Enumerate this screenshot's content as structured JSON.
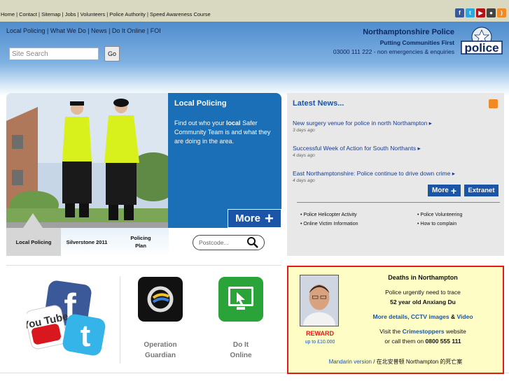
{
  "top_links": "Home | Contact | Sitemap | Jobs | Volunteers | Police Authority | Speed Awareness Course",
  "social_icons": [
    "facebook-icon",
    "twitter-icon",
    "youtube-icon",
    "flickr-icon",
    "rss-icon"
  ],
  "main_nav": "Local Policing | What We Do | News | Do It Online | FOI",
  "search": {
    "placeholder": "Site Search",
    "button": "Go"
  },
  "brand": {
    "name": "Northamptonshire Police",
    "tagline": "Putting Communities First",
    "phone": "03000 111 222 - non emergencies & enquiries",
    "logo_text": "police"
  },
  "local_policing": {
    "title": "Local Policing",
    "desc_pre": "Find out who your ",
    "desc_bold": "local",
    "desc_post": " Safer Community Team is and what they are doing in the area.",
    "more": "More",
    "tabs": [
      "Local Policing",
      "Silverstone 2011",
      "Policing Plan"
    ],
    "postcode_placeholder": "Postcode..."
  },
  "news": {
    "title": "Latest News...",
    "items": [
      {
        "title": "New surgery venue for police in north Northampton",
        "date": "3 days ago"
      },
      {
        "title": "Successful Week of Action for South Northants",
        "date": "4 days ago"
      },
      {
        "title": "East Northamptonshire: Police continue to drive down crime",
        "date": "4 days ago"
      }
    ],
    "more": "More",
    "extranet": "Extranet",
    "quick_links": [
      "Police Helicopter Activity",
      "Police Volunteering",
      "Online Victim Information",
      "How to complain"
    ]
  },
  "bottom": {
    "op_guardian": "Operation Guardian",
    "do_it_online": "Do It Online",
    "youtube_text": "You Tube"
  },
  "appeal": {
    "title": "Deaths in Northampton",
    "line1": "Police urgently need to trace",
    "line2": "52 year old Anxiang Du",
    "details_pre": "More details",
    "details_mid": "CCTV images",
    "details_amp": "&",
    "details_video": "Video",
    "visit_pre": "Visit the ",
    "visit_link": "Crimestoppers",
    "visit_post": " website",
    "call": "or call them on ",
    "call_num": "0800 555 111",
    "reward": "REWARD",
    "reward_amount": "up to £10.000",
    "mandarin_link": "Mandarin version",
    "mandarin_text": "在北安普顿 Northampton 的死亡案"
  },
  "colors": {
    "brand_blue": "#1a55a8",
    "appeal_red": "#e01b1b",
    "appeal_bg": "#fffdc6"
  }
}
